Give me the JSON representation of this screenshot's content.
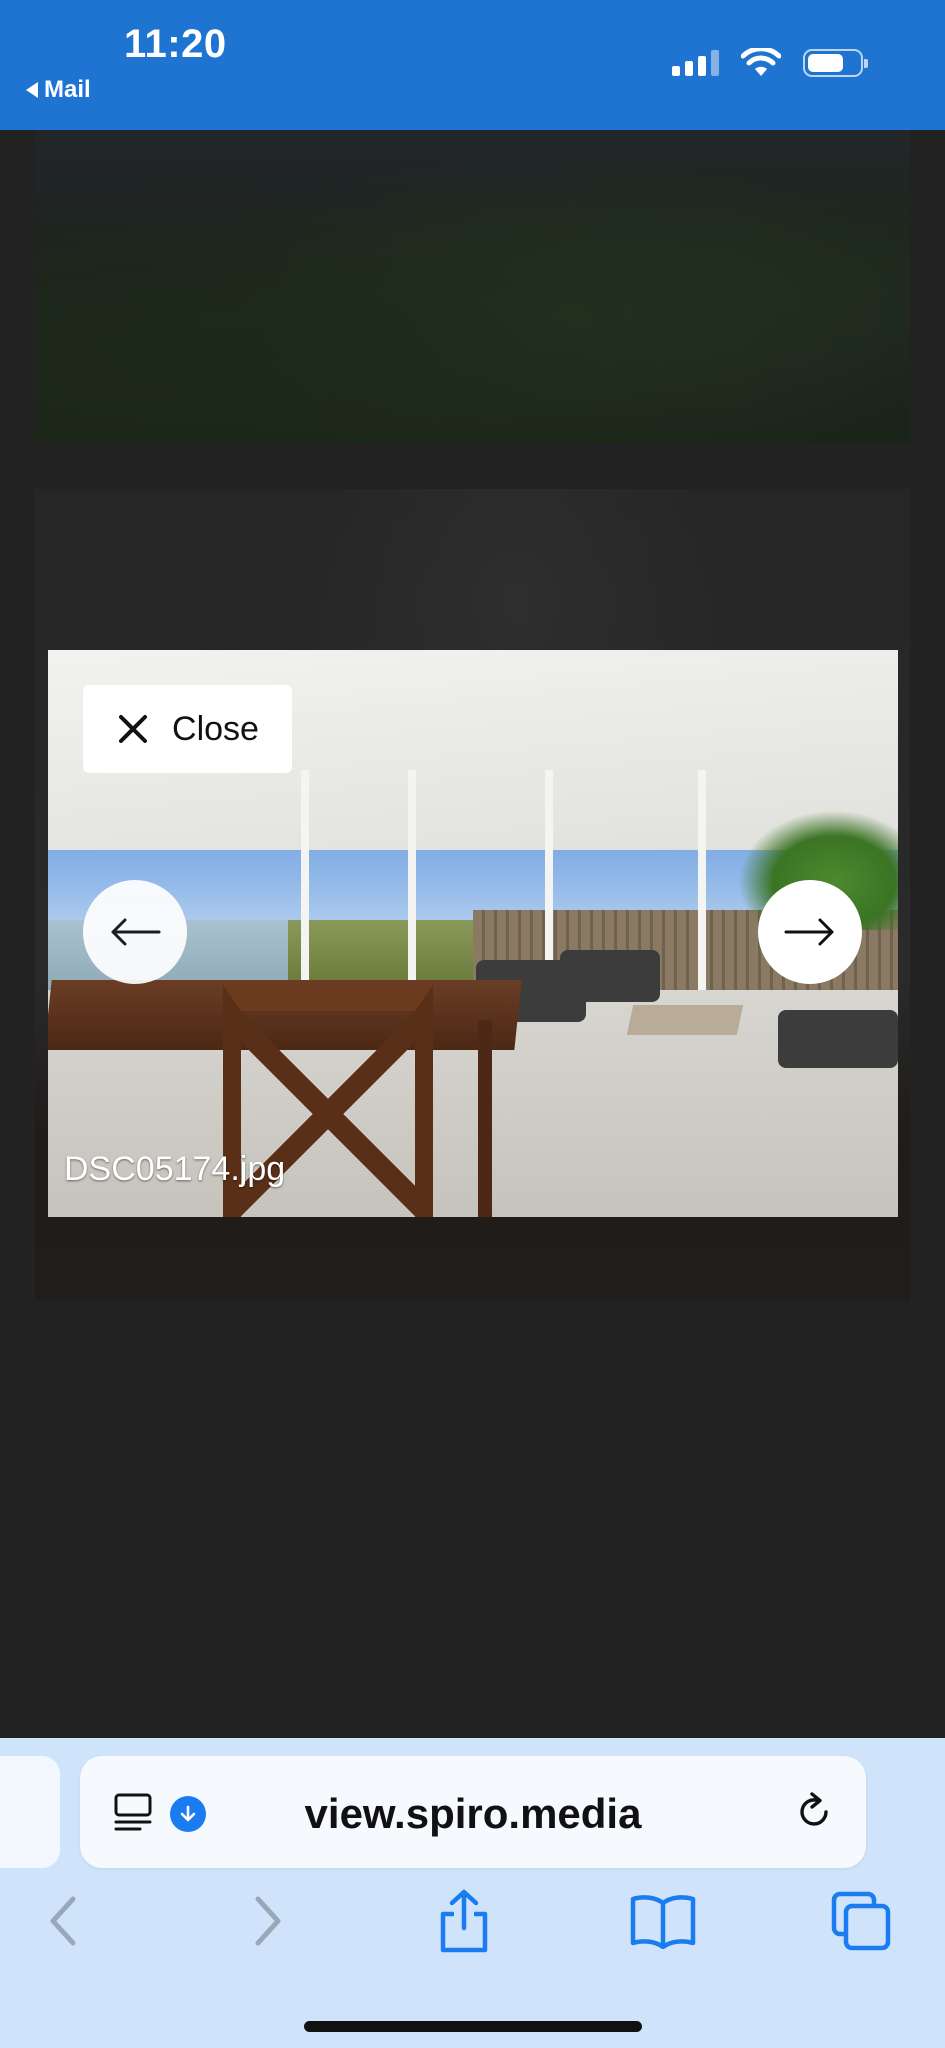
{
  "status_bar": {
    "time": "11:20",
    "back_app": "Mail",
    "icons": [
      "cellular-signal-icon",
      "wifi-icon",
      "battery-icon"
    ]
  },
  "lightbox": {
    "close_label": "Close",
    "filename": "DSC05174.jpg",
    "prev_icon": "arrow-left-icon",
    "next_icon": "arrow-right-icon"
  },
  "browser": {
    "url": "view.spiro.media",
    "icons": [
      "reader-icon",
      "download-badge-icon",
      "reload-icon",
      "back-icon",
      "forward-icon",
      "share-icon",
      "bookmarks-icon",
      "tabs-icon"
    ]
  },
  "colors": {
    "status_bar": "#1f74d1",
    "page_bg": "#222222",
    "toolbar_bg": "#cfe4fb",
    "accent": "#1a7cf0"
  }
}
